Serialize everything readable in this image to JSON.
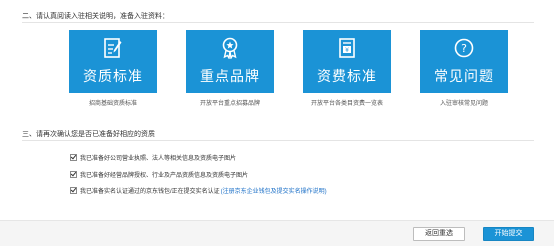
{
  "step2": {
    "title": "二、请认真阅读入驻相关说明，准备入驻资料："
  },
  "cards": [
    {
      "icon": "edit-document-icon",
      "title": "资质标准",
      "caption": "招商基础资质标准"
    },
    {
      "icon": "award-badge-icon",
      "title": "重点品牌",
      "caption": "开放平台重点招募品牌"
    },
    {
      "icon": "fee-document-icon",
      "title": "资费标准",
      "caption": "开放平台各类目资费一览表"
    },
    {
      "icon": "question-icon",
      "title": "常见问题",
      "caption": "入驻审核常见问题"
    }
  ],
  "step3": {
    "title": "三、请再次确认您是否已准备好相应的资质"
  },
  "checks": [
    {
      "label": "我已准备好公司营业执照、法人等相关信息及资质电子图片",
      "checked": true
    },
    {
      "label": "我已准备好经营品牌授权、行业及产品资质信息及资质电子图片",
      "checked": true
    },
    {
      "label": "我已准备实名认证通过的京东钱包/正在提交实名认证",
      "link": "(注册京东企业钱包及提交实名操作说明)",
      "checked": true
    }
  ],
  "buttons": {
    "reset": "返回重选",
    "submit": "开始提交"
  },
  "colors": {
    "accent": "#1b93d6",
    "link": "#1a6fc7"
  }
}
